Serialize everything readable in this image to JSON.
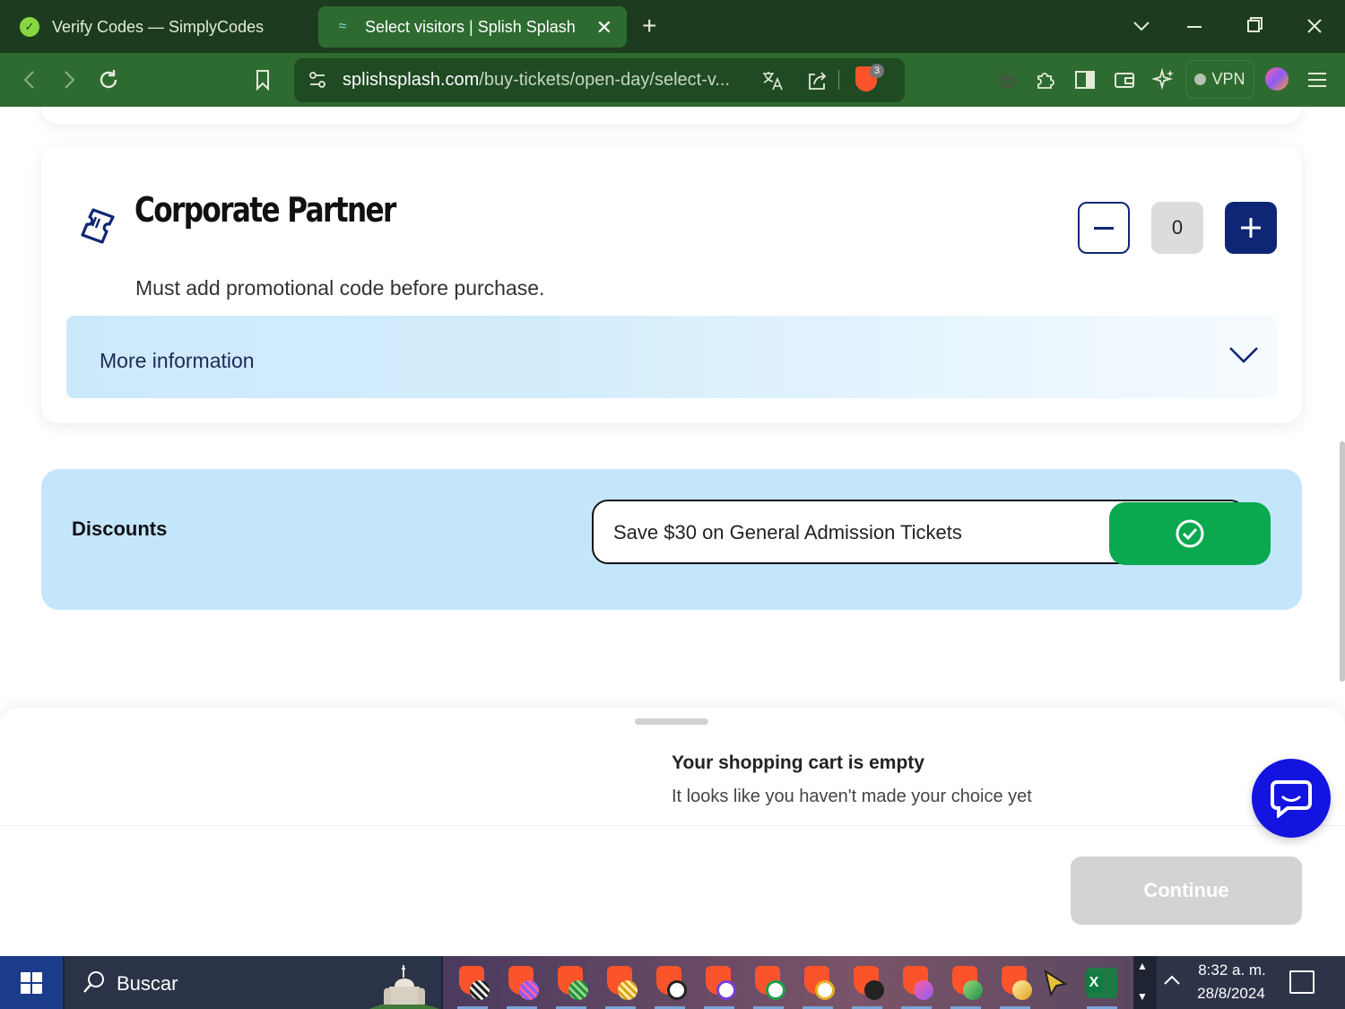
{
  "browser": {
    "tabs": [
      {
        "title": "Verify Codes — SimplyCodes",
        "active": false
      },
      {
        "title": "Select visitors | Splish Splash",
        "active": true
      }
    ],
    "url_host": "splishsplash.com",
    "url_path": "/buy-tickets/open-day/select-v...",
    "shield_count": "3",
    "vpn_label": "VPN",
    "accent_color": "#2e6b31"
  },
  "ticket": {
    "title": "Corporate Partner",
    "subtitle": "Must add promotional code before purchase.",
    "quantity": "0",
    "more_info_label": "More information"
  },
  "discounts": {
    "label": "Discounts",
    "code_value": "Save $30 on General Admission Tickets",
    "apply_color": "#0aa84f"
  },
  "cart": {
    "title": "Your shopping cart is empty",
    "message": "It looks like you haven't made your choice yet",
    "continue_label": "Continue"
  },
  "taskbar": {
    "search_placeholder": "Buscar",
    "time": "8:32 a. m.",
    "date": "28/8/2024"
  }
}
